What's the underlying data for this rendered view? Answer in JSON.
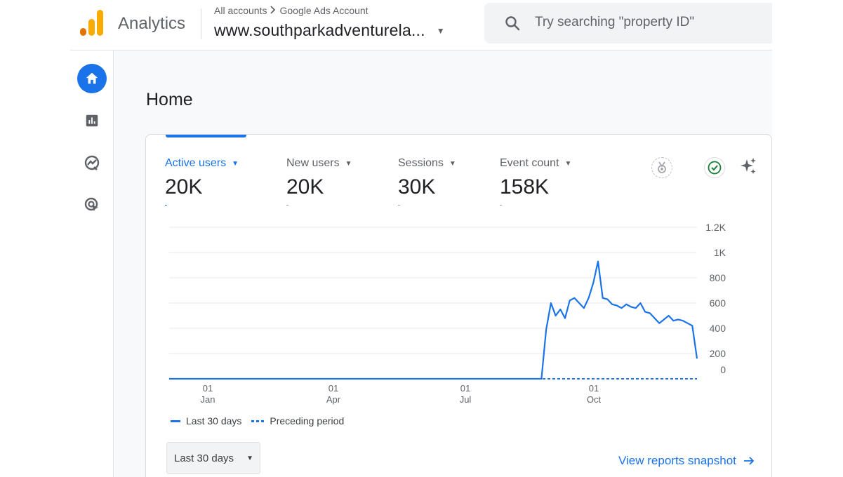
{
  "header": {
    "app_name": "Analytics",
    "breadcrumb": {
      "account": "All accounts",
      "separator": ">",
      "sub_account": "Google Ads Account"
    },
    "property": "www.southparkadventurela...",
    "search_placeholder": "Try searching \"property ID\""
  },
  "sidebar": {
    "items": [
      {
        "icon": "home-icon",
        "active": true
      },
      {
        "icon": "reports-icon",
        "active": false
      },
      {
        "icon": "explore-icon",
        "active": false
      },
      {
        "icon": "advertising-icon",
        "active": false
      }
    ]
  },
  "main": {
    "title": "Home",
    "metrics": [
      {
        "label": "Active users",
        "value": "20K",
        "active": true
      },
      {
        "label": "New users",
        "value": "20K",
        "active": false
      },
      {
        "label": "Sessions",
        "value": "30K",
        "active": false
      },
      {
        "label": "Event count",
        "value": "158K",
        "active": false
      }
    ],
    "legend": {
      "current": "Last 30 days",
      "previous": "Preceding period"
    },
    "date_range": "Last 30 days",
    "snapshot_link": "View reports snapshot"
  },
  "colors": {
    "accent": "#1a73e8",
    "logo_orange": "#f9ab00",
    "logo_dark": "#e37400",
    "check_green": "#188038"
  },
  "chart_data": {
    "type": "line",
    "x_ticks": [
      {
        "day": "01",
        "month": "Jan"
      },
      {
        "day": "01",
        "month": "Apr"
      },
      {
        "day": "01",
        "month": "Jul"
      },
      {
        "day": "01",
        "month": "Oct"
      }
    ],
    "y_ticks": [
      "1.2K",
      "1K",
      "800",
      "600",
      "400",
      "200",
      "0"
    ],
    "ylim": [
      0,
      1200
    ],
    "grid": true,
    "series": [
      {
        "name": "Last 30 days",
        "style": "solid",
        "values": [
          0,
          0,
          0,
          0,
          0,
          0,
          0,
          0,
          0,
          0,
          0,
          0,
          0,
          0,
          0,
          0,
          0,
          0,
          0,
          0,
          0,
          0,
          0,
          0,
          0,
          0,
          0,
          0,
          0,
          0,
          0,
          0,
          0,
          0,
          0,
          0,
          0,
          0,
          0,
          0,
          0,
          0,
          0,
          0,
          0,
          0,
          0,
          0,
          0,
          0,
          0,
          0,
          0,
          0,
          0,
          0,
          0,
          0,
          0,
          0,
          0,
          0,
          0,
          0,
          0,
          0,
          0,
          0,
          0,
          0,
          0,
          0,
          0,
          0,
          0,
          0,
          0,
          0,
          0,
          0,
          390,
          600,
          500,
          550,
          480,
          620,
          640,
          600,
          560,
          640,
          760,
          930,
          640,
          630,
          590,
          580,
          560,
          590,
          570,
          560,
          600,
          530,
          520,
          480,
          440,
          470,
          500,
          460,
          470,
          460,
          440,
          420,
          160
        ]
      },
      {
        "name": "Preceding period",
        "style": "dashed",
        "values": [
          0
        ]
      }
    ]
  }
}
